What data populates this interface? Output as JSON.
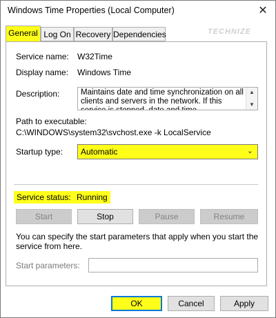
{
  "window": {
    "title": "Windows Time Properties (Local Computer)",
    "close_glyph": "✕"
  },
  "tabs": [
    {
      "label": "General",
      "active": true
    },
    {
      "label": "Log On",
      "active": false
    },
    {
      "label": "Recovery",
      "active": false
    },
    {
      "label": "Dependencies",
      "active": false
    }
  ],
  "watermark": "TECHNIZE",
  "fields": {
    "service_name_label": "Service name:",
    "service_name_value": "W32Time",
    "display_name_label": "Display name:",
    "display_name_value": "Windows Time",
    "description_label": "Description:",
    "description_value": "Maintains date and time synchronization on all clients and servers in the network. If this service is stopped, date and time synchronization will be",
    "path_label": "Path to executable:",
    "path_value": "C:\\WINDOWS\\system32\\svchost.exe -k LocalService",
    "startup_type_label": "Startup type:",
    "startup_type_value": "Automatic"
  },
  "status": {
    "label": "Service status:",
    "value": "Running"
  },
  "service_buttons": {
    "start": "Start",
    "stop": "Stop",
    "pause": "Pause",
    "resume": "Resume"
  },
  "help_text": "You can specify the start parameters that apply when you start the service from here.",
  "start_parameters": {
    "label": "Start parameters:",
    "value": ""
  },
  "dialog_buttons": {
    "ok": "OK",
    "cancel": "Cancel",
    "apply": "Apply"
  },
  "colors": {
    "highlight": "#ffff1a",
    "focus_border": "#0078d7"
  },
  "icons": {
    "close": "close-icon",
    "dropdown": "chevron-down-icon",
    "scroll_up": "scroll-up-arrow-icon",
    "scroll_down": "scroll-down-arrow-icon"
  }
}
